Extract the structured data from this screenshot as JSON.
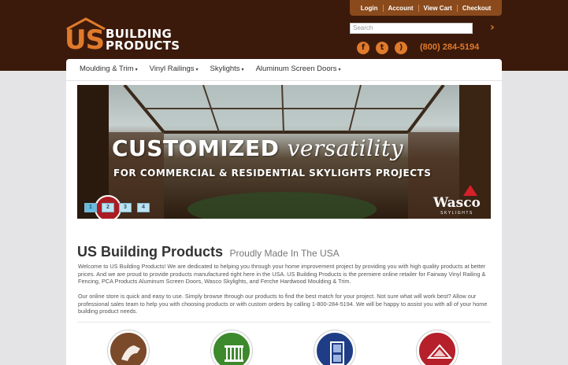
{
  "header": {
    "logo_mark": "US",
    "logo_line1": "BUILDING",
    "logo_line2": "PRODUCTS",
    "account_links": [
      "Login",
      "Account",
      "View Cart",
      "Checkout"
    ],
    "search_placeholder": "Search",
    "search_go": "›",
    "social_icons": [
      "facebook-icon",
      "twitter-icon",
      "rss-icon"
    ],
    "phone": "(800) 284-5194"
  },
  "nav": {
    "items": [
      "Moulding & Trim",
      "Vinyl Railings",
      "Skylights",
      "Aluminum Screen Doors"
    ],
    "caret": "▾"
  },
  "banner": {
    "headline_bold": "CUSTOMIZED",
    "headline_script": "versatility",
    "subheadline": "FOR COMMERCIAL & RESIDENTIAL SKYLIGHTS PROJECTS",
    "brand_name": "Wasco",
    "brand_sub": "SKYLIGHTS",
    "slides": [
      "1",
      "2",
      "3",
      "4"
    ],
    "active_slide": 1
  },
  "main": {
    "title": "US Building Products",
    "subtitle": "Proudly Made In The USA",
    "paragraph1": "Welcome to US Building Products! We are dedicated to helping you through your home improvement project by providing you with high quality products at better prices. And we are proud to provide products manufactured right here in the USA. US Building Products is the premiere online retailer for Fairway Vinyl Railing & Fencing, PCA Products Aluminum Screen Doors, Wasco Skylights, and Ferche Hardwood Moulding & Trim.",
    "paragraph2": "Our online store is quick and easy to use. Simply browse through our products to find the best match for your project. Not sure what will work best? Allow our professional sales team to help you with choosing products or with custom orders by calling 1-800-284-5194. We will be happy to assist you with all of your home building product needs."
  },
  "categories": [
    {
      "icon": "moulding-icon",
      "color": "#7a4a2a"
    },
    {
      "icon": "railing-icon",
      "color": "#3d8a2c"
    },
    {
      "icon": "screen-door-icon",
      "color": "#1f3d86"
    },
    {
      "icon": "skylight-icon",
      "color": "#b5202a"
    }
  ],
  "colors": {
    "header_bg": "#3b1a0b",
    "accent": "#e07a2c",
    "page_bg": "#e4e4e6"
  }
}
